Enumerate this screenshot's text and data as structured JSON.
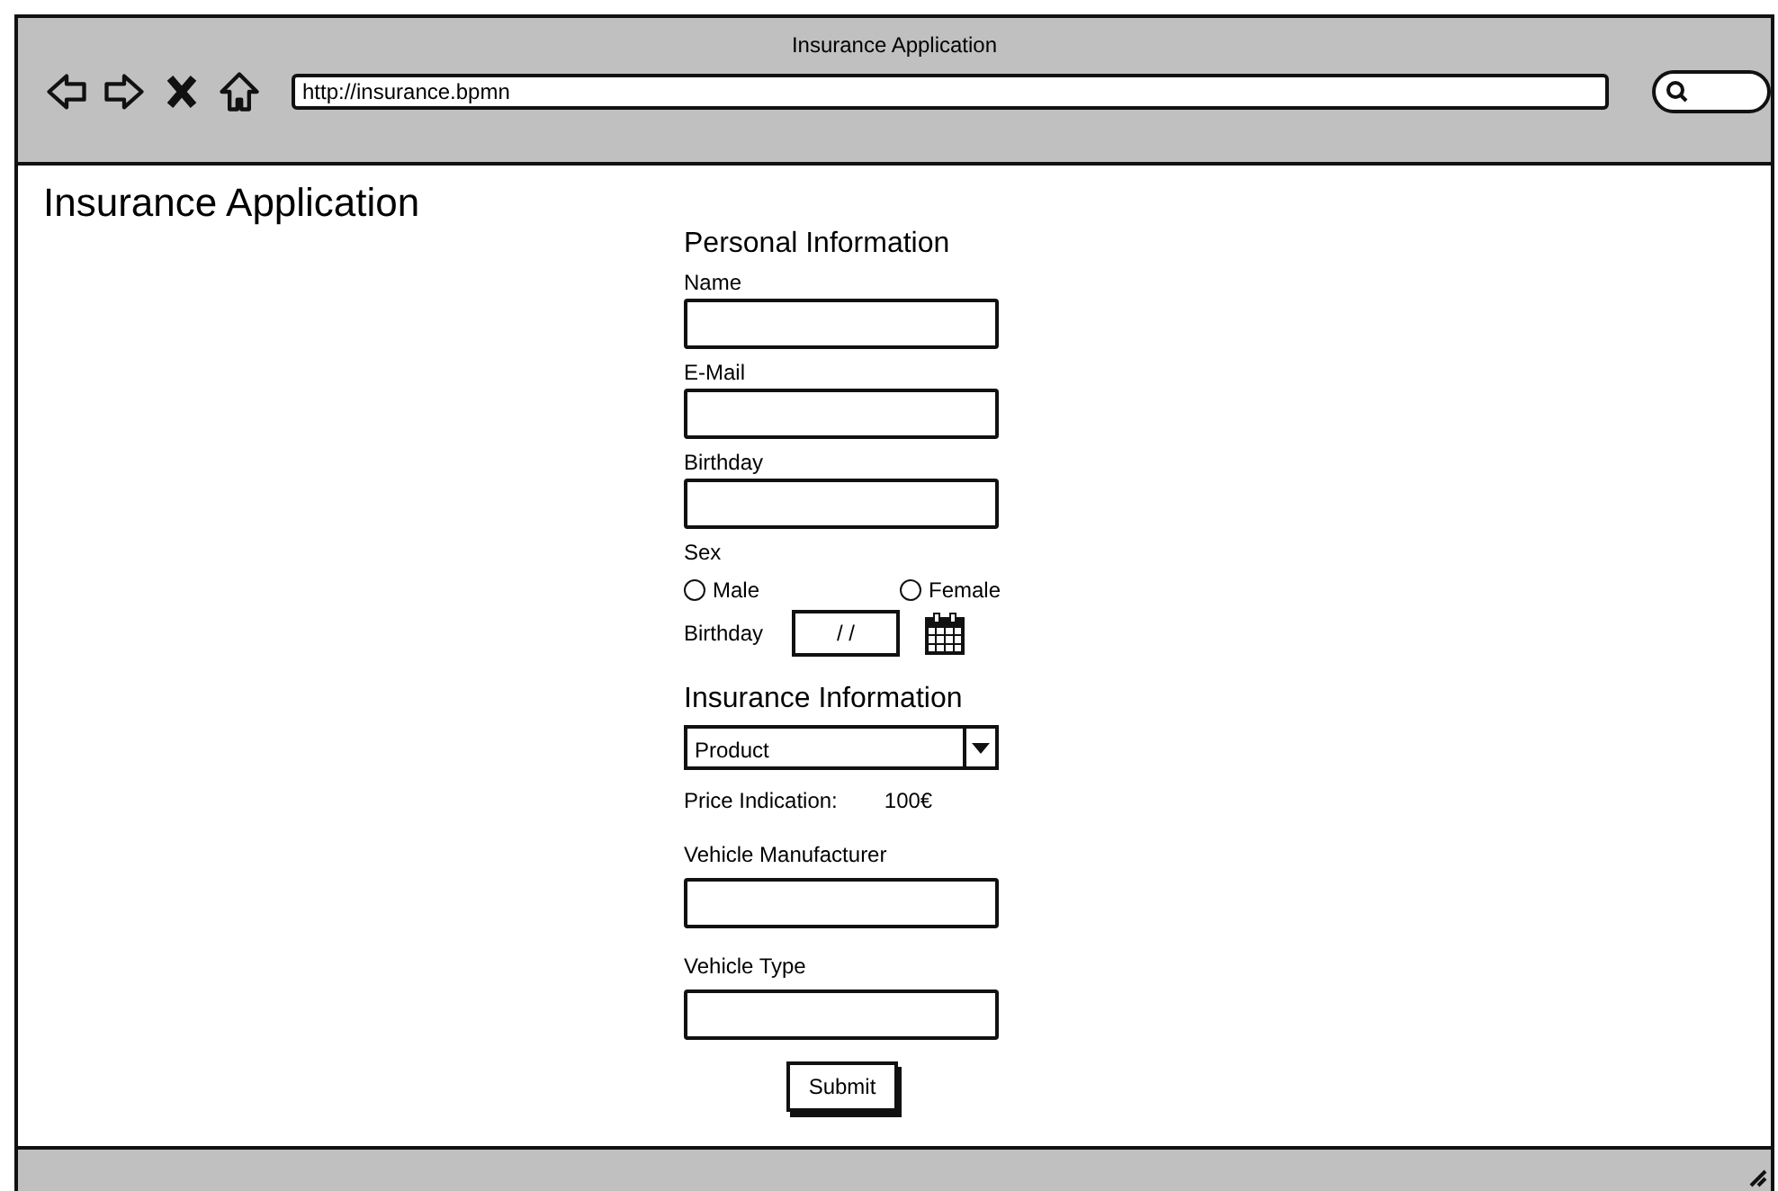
{
  "window": {
    "title": "Insurance Application",
    "address": "http://insurance.bpmn"
  },
  "page": {
    "heading": "Insurance Application"
  },
  "form": [
    {
      "kind": "heading",
      "text": "Personal Information"
    },
    {
      "kind": "field",
      "label": "Name"
    },
    {
      "kind": "field",
      "label": "E-Mail"
    },
    {
      "kind": "field",
      "label": "Birthday"
    },
    {
      "kind": "radio-group",
      "label": "Sex",
      "options": [
        {
          "label": "Male",
          "selected": false
        },
        {
          "label": "Female",
          "selected": false
        }
      ]
    },
    {
      "kind": "date",
      "label": "Birthday",
      "value": "/ /"
    },
    {
      "kind": "heading",
      "text": "Insurance Information"
    },
    {
      "kind": "select",
      "value": "Product"
    },
    {
      "kind": "price",
      "label": "Price Indication:",
      "value": "100€"
    },
    {
      "kind": "field",
      "label": "Vehicle Manufacturer",
      "spaced": true
    },
    {
      "kind": "field",
      "label": "Vehicle Type",
      "spaced": true
    },
    {
      "kind": "button",
      "text": "Submit"
    }
  ]
}
